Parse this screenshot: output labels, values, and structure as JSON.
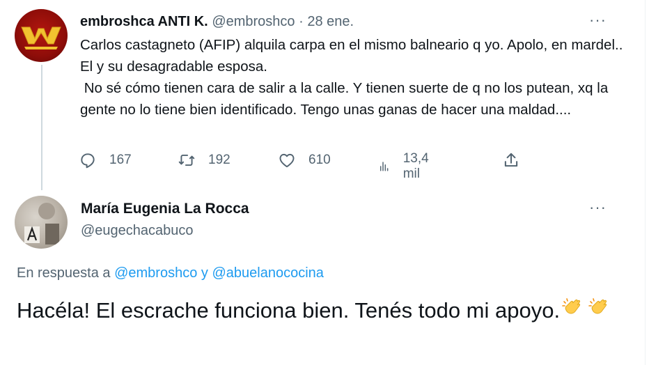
{
  "tweet1": {
    "author_name": "embroshca ANTI K.",
    "handle": "@embroshco",
    "separator": "·",
    "date": "28 ene.",
    "text": "Carlos castagneto (AFIP) alquila carpa en el mismo balneario q yo. Apolo, en mardel.. El y su desagradable esposa.\n No sé cómo tienen cara de salir a la calle. Y tienen suerte de q no los putean, xq la gente no lo tiene bien identificado. Tengo unas ganas de hacer una maldad....",
    "more": "···",
    "actions": {
      "replies": "167",
      "retweets": "192",
      "likes": "610",
      "views": "13,4 mil"
    }
  },
  "tweet2": {
    "author_name": "María Eugenia La Rocca",
    "handle": "@eugechacabuco",
    "more": "···",
    "reply_prefix": "En respuesta a",
    "reply_mention1": "@embroshco",
    "reply_conjunction": "y",
    "reply_mention2": "@abuelanococina",
    "text": "Hacéla! El escrache funciona bien. Tenés todo mi apoyo."
  },
  "colors": {
    "text_primary": "#0f1419",
    "text_secondary": "#536471",
    "link": "#1d9bf0",
    "thread_line": "#cfd9de"
  }
}
